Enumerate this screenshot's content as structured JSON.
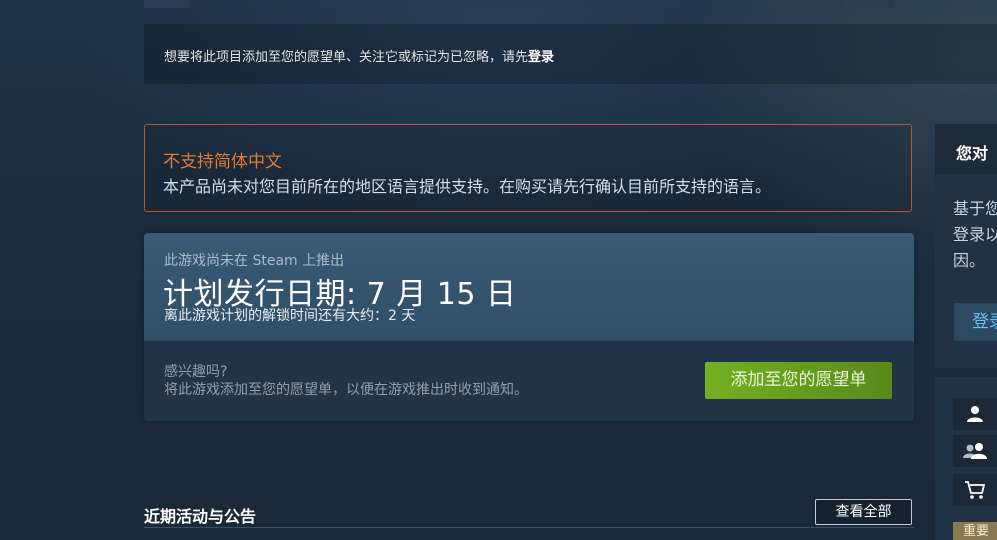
{
  "login_bar": {
    "text": "想要将此项目添加至您的愿望单、关注它或标记为已忽略，请先",
    "link": "登录"
  },
  "language_notice": {
    "title": "不支持简体中文",
    "description": "本产品尚未对您目前所在的地区语言提供支持。在购买请先行确认目前所支持的语言。"
  },
  "release": {
    "not_released": "此游戏尚未在 Steam 上推出",
    "planned_date": "计划发行日期: 7 月 15 日",
    "unlock_time": "离此游戏计划的解锁时间还有大约：2 天",
    "interested": "感兴趣吗?",
    "wishlist_hint": "将此游戏添加至您的愿望单，以便在游戏推出时收到通知。",
    "wishlist_button": "添加至您的愿望单"
  },
  "news": {
    "title": "近期活动与公告",
    "view_all": "查看全部"
  },
  "sidebar": {
    "header": "您对",
    "description_lines": [
      "基于您",
      "登录以",
      "因。"
    ],
    "login_button": "登录",
    "icons": [
      "user-icon",
      "friends-icon",
      "cart-icon"
    ],
    "tag": "重要"
  },
  "colors": {
    "background": "#1b2838",
    "warning_orange": "#e3792c",
    "wishlist_green": "#75b022",
    "link_blue": "#66c0f4"
  }
}
